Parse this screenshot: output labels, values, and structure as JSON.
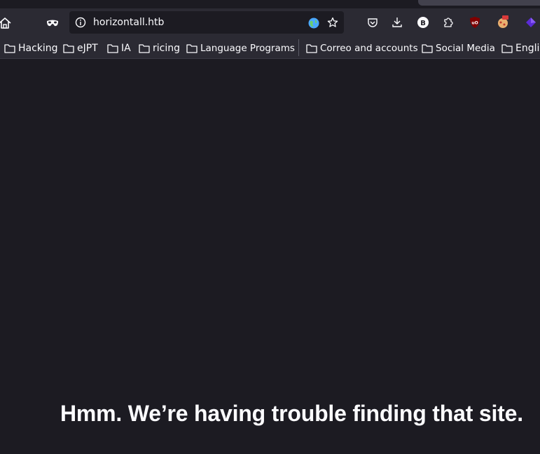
{
  "browser": {
    "url": "horizontall.htb",
    "toolbar_icons": [
      "home-icon",
      "private-mask-icon",
      "info-icon",
      "globe-icon",
      "star-icon",
      "pocket-icon",
      "download-icon",
      "b-extension-icon",
      "extensions-puzzle-icon",
      "ublock-icon",
      "pizza-extension-icon",
      "purple-extension-icon"
    ]
  },
  "bookmarks": [
    {
      "label": "Hacking"
    },
    {
      "label": "eJPT"
    },
    {
      "label": "IA"
    },
    {
      "label": "ricing"
    },
    {
      "label": "Language Programs"
    },
    {
      "label": "Correo and accounts"
    },
    {
      "label": "Social Media"
    },
    {
      "label": "Englis"
    }
  ],
  "page": {
    "error_title": "Hmm. We’re having trouble finding that site."
  },
  "colors": {
    "background": "#1c1b22",
    "toolbar": "#2b2a33",
    "text": "#fbfbfe"
  }
}
